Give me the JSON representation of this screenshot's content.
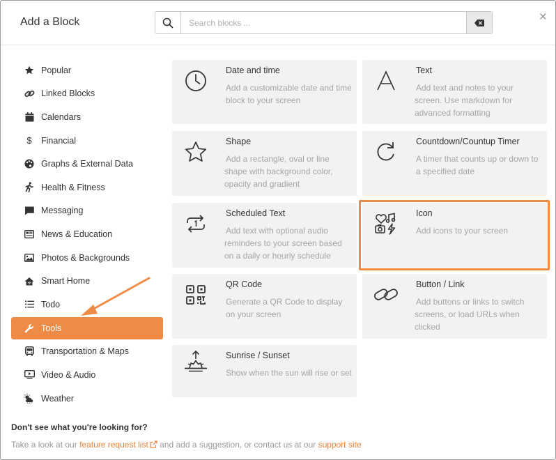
{
  "header": {
    "title": "Add a Block",
    "search_placeholder": "Search blocks ..."
  },
  "sidebar": {
    "items": [
      {
        "label": "Popular",
        "icon": "star-icon"
      },
      {
        "label": "Linked Blocks",
        "icon": "link-icon"
      },
      {
        "label": "Calendars",
        "icon": "calendar-icon"
      },
      {
        "label": "Financial",
        "icon": "dollar-icon"
      },
      {
        "label": "Graphs & External Data",
        "icon": "palette-icon"
      },
      {
        "label": "Health & Fitness",
        "icon": "running-icon"
      },
      {
        "label": "Messaging",
        "icon": "message-icon"
      },
      {
        "label": "News & Education",
        "icon": "newspaper-icon"
      },
      {
        "label": "Photos & Backgrounds",
        "icon": "image-icon"
      },
      {
        "label": "Smart Home",
        "icon": "smart-home-icon"
      },
      {
        "label": "Todo",
        "icon": "list-icon"
      },
      {
        "label": "Tools",
        "icon": "wrench-icon",
        "active": true
      },
      {
        "label": "Transportation & Maps",
        "icon": "bus-icon"
      },
      {
        "label": "Video & Audio",
        "icon": "video-icon"
      },
      {
        "label": "Weather",
        "icon": "weather-icon"
      }
    ]
  },
  "blocks": [
    {
      "title": "Date and time",
      "desc": "Add a customizable date and time block to your screen",
      "icon": "clock-icon"
    },
    {
      "title": "Text",
      "desc": "Add text and notes to your screen. Use markdown for advanced formatting",
      "icon": "text-a-icon"
    },
    {
      "title": "Shape",
      "desc": "Add a rectangle, oval or line shape with background color, opacity and gradient",
      "icon": "star-outline-icon"
    },
    {
      "title": "Countdown/Countup Timer",
      "desc": "A timer that counts up or down to a specified date",
      "icon": "redo-icon"
    },
    {
      "title": "Scheduled Text",
      "desc": "Add text with optional audio reminders to your screen based on a daily or hourly schedule",
      "icon": "repeat-once-icon"
    },
    {
      "title": "Icon",
      "desc": "Add icons to your screen",
      "icon": "icons-icon"
    },
    {
      "title": "QR Code",
      "desc": "Generate a QR Code to display on your screen",
      "icon": "qr-code-icon"
    },
    {
      "title": "Button / Link",
      "desc": "Add buttons or links to switch screens, or load URLs when clicked",
      "icon": "chain-link-icon"
    },
    {
      "title": "Sunrise / Sunset",
      "desc": "Show when the sun will rise or set",
      "icon": "sunrise-icon"
    }
  ],
  "footer": {
    "question": "Don't see what you're looking for?",
    "text_before": "Take a look at our ",
    "feature_link": "feature request list",
    "text_middle": " and add a suggestion, or contact us at our ",
    "support_link": "support site"
  },
  "colors": {
    "accent": "#ee8b47",
    "card_bg": "#f2f2f2",
    "muted_text": "#a6a6a6"
  }
}
